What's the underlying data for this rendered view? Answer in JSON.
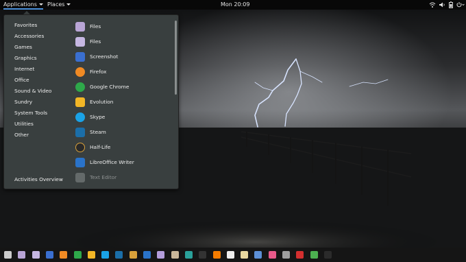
{
  "topbar": {
    "applications_label": "Applications",
    "places_label": "Places",
    "clock": "Mon 20:09",
    "status_icons": [
      "wifi-icon",
      "volume-icon",
      "battery-icon",
      "power-icon"
    ]
  },
  "menu": {
    "categories": [
      "Favorites",
      "Accessories",
      "Games",
      "Graphics",
      "Internet",
      "Office",
      "Sound & Video",
      "Sundry",
      "System Tools",
      "Utilities",
      "Other"
    ],
    "activities_label": "Activities Overview",
    "apps": [
      {
        "label": "Files",
        "icon": "folder-icon",
        "color": "#b9a5d6"
      },
      {
        "label": "Files",
        "icon": "folder-icon",
        "color": "#c6b7e2"
      },
      {
        "label": "Screenshot",
        "icon": "camera-icon",
        "color": "#3a6fd0"
      },
      {
        "label": "Firefox",
        "icon": "firefox-icon",
        "color": "#f08a24"
      },
      {
        "label": "Google Chrome",
        "icon": "chrome-icon",
        "color": "#2ea84a"
      },
      {
        "label": "Evolution",
        "icon": "mail-icon",
        "color": "#f2b626"
      },
      {
        "label": "Skype",
        "icon": "skype-icon",
        "color": "#1aa2e6"
      },
      {
        "label": "Steam",
        "icon": "steam-icon",
        "color": "#1b6ea8"
      },
      {
        "label": "Half-Life",
        "icon": "half-life-icon",
        "color": "#2a2a2a"
      },
      {
        "label": "LibreOffice Writer",
        "icon": "writer-icon",
        "color": "#2a73c9"
      },
      {
        "label": "Text Editor",
        "icon": "text-editor-icon",
        "color": "#9aa0a0"
      }
    ]
  },
  "dock": {
    "icons": [
      {
        "name": "grid-icon",
        "color": "#cccccc"
      },
      {
        "name": "folder-icon",
        "color": "#b9a5d6"
      },
      {
        "name": "folder-icon",
        "color": "#c6b7e2"
      },
      {
        "name": "camera-icon",
        "color": "#3a6fd0"
      },
      {
        "name": "firefox-icon",
        "color": "#f08a24"
      },
      {
        "name": "chrome-icon",
        "color": "#2ea84a"
      },
      {
        "name": "mail-icon",
        "color": "#f2b626"
      },
      {
        "name": "skype-icon",
        "color": "#1aa2e6"
      },
      {
        "name": "steam-icon",
        "color": "#1b6ea8"
      },
      {
        "name": "half-life-icon",
        "color": "#d9a13a"
      },
      {
        "name": "writer-icon",
        "color": "#2a73c9"
      },
      {
        "name": "text-editor-icon",
        "color": "#b39ddb"
      },
      {
        "name": "box-icon",
        "color": "#c9b79a"
      },
      {
        "name": "image-viewer-icon",
        "color": "#2aa19a"
      },
      {
        "name": "video-player-icon",
        "color": "#333333"
      },
      {
        "name": "media-icon",
        "color": "#f57c00"
      },
      {
        "name": "music-icon",
        "color": "#eeeeee"
      },
      {
        "name": "archive-icon",
        "color": "#e8d8a0"
      },
      {
        "name": "settings-icon",
        "color": "#5c8fd6"
      },
      {
        "name": "disk-icon",
        "color": "#e85a8a"
      },
      {
        "name": "calculator-icon",
        "color": "#9e9e9e"
      },
      {
        "name": "fedora-icon",
        "color": "#d32f2f"
      },
      {
        "name": "nvidia-icon",
        "color": "#4caf50"
      },
      {
        "name": "terminal-icon",
        "color": "#2b2b2b"
      }
    ]
  }
}
